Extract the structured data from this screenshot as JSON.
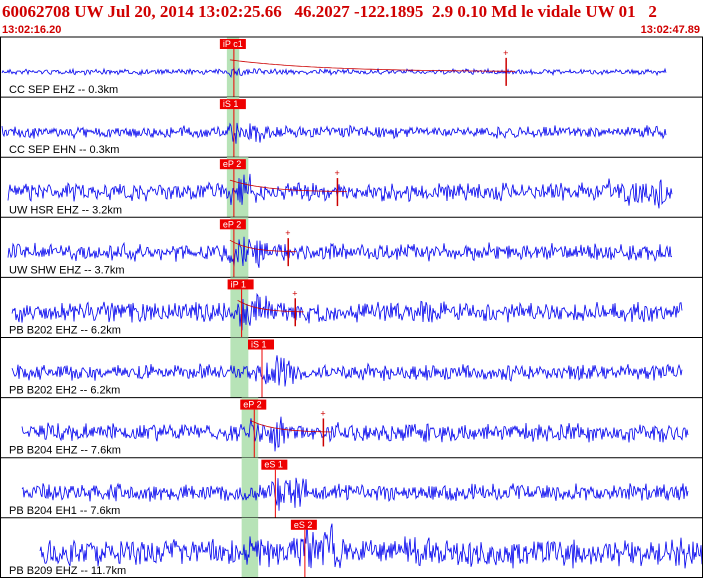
{
  "header": {
    "title": "60062708 UW Jul 20, 2014 13:02:25.66   46.2027 -122.1895  2.9 0.10 Md le vidale UW 01   2",
    "start_time": "13:02:16.20",
    "end_time": "13:02:47.89"
  },
  "colors": {
    "trace": "#0000ee",
    "pick_bg": "#ee0000",
    "label": "#cc0000",
    "window": "#b7e3b7",
    "fit": "#cc0000"
  },
  "chart_data": {
    "type": "seismogram",
    "time_range": [
      "13:02:16.20",
      "13:02:47.89"
    ],
    "traces": [
      {
        "label": "CC SEP EHZ -- 0.3km",
        "pick": "iP c1",
        "pick_t": 0.327,
        "win": [
          0.327,
          0.336
        ],
        "amp": 1,
        "fit": true,
        "event_t": 0.72,
        "s_t": 0.7
      },
      {
        "label": "CC SEP EHN -- 0.3km",
        "pick": "iS 1",
        "pick_t": 0.327,
        "win": [
          0.327,
          0.336
        ],
        "amp": 1,
        "fit": false
      },
      {
        "label": "UW HSR EHZ -- 3.2km",
        "pick": "eP 2",
        "pick_t": 0.327,
        "win": [
          0.327,
          0.349
        ],
        "amp": 1,
        "fit": true,
        "event_t": 0.48,
        "s_t": 0.48
      },
      {
        "label": "UW SHW EHZ -- 3.7km",
        "pick": "eP 2",
        "pick_t": 0.327,
        "win": [
          0.332,
          0.349
        ],
        "amp": 1,
        "fit": true,
        "event_t": 0.41,
        "s_t": 0.41
      },
      {
        "label": "PB B202 EHZ -- 6.2km",
        "pick": "iP 1",
        "pick_t": 0.338,
        "win": [
          0.332,
          0.349
        ],
        "amp": 1,
        "fit": true,
        "event_t": 0.42,
        "s_t": 0.42
      },
      {
        "label": "PB B202 EH2 -- 6.2km",
        "pick": "iS 1",
        "pick_t": 0.367,
        "win": [
          0.332,
          0.349
        ],
        "amp": 1,
        "fit": false
      },
      {
        "label": "PB B204 EHZ -- 7.6km",
        "pick": "eP 2",
        "pick_t": 0.356,
        "win": [
          0.348,
          0.363
        ],
        "amp": 1,
        "fit": true,
        "event_t": 0.46,
        "s_t": 0.46
      },
      {
        "label": "PB B204 EH1 -- 7.6km",
        "pick": "eS 1",
        "pick_t": 0.386,
        "win": [
          0.348,
          0.363
        ],
        "amp": 1,
        "fit": false
      },
      {
        "label": "PB B209 EHZ -- 11.7km",
        "pick": "eS 2",
        "pick_t": 0.428,
        "win": [
          0.348,
          0.363
        ],
        "amp": 1,
        "fit": false
      }
    ]
  }
}
